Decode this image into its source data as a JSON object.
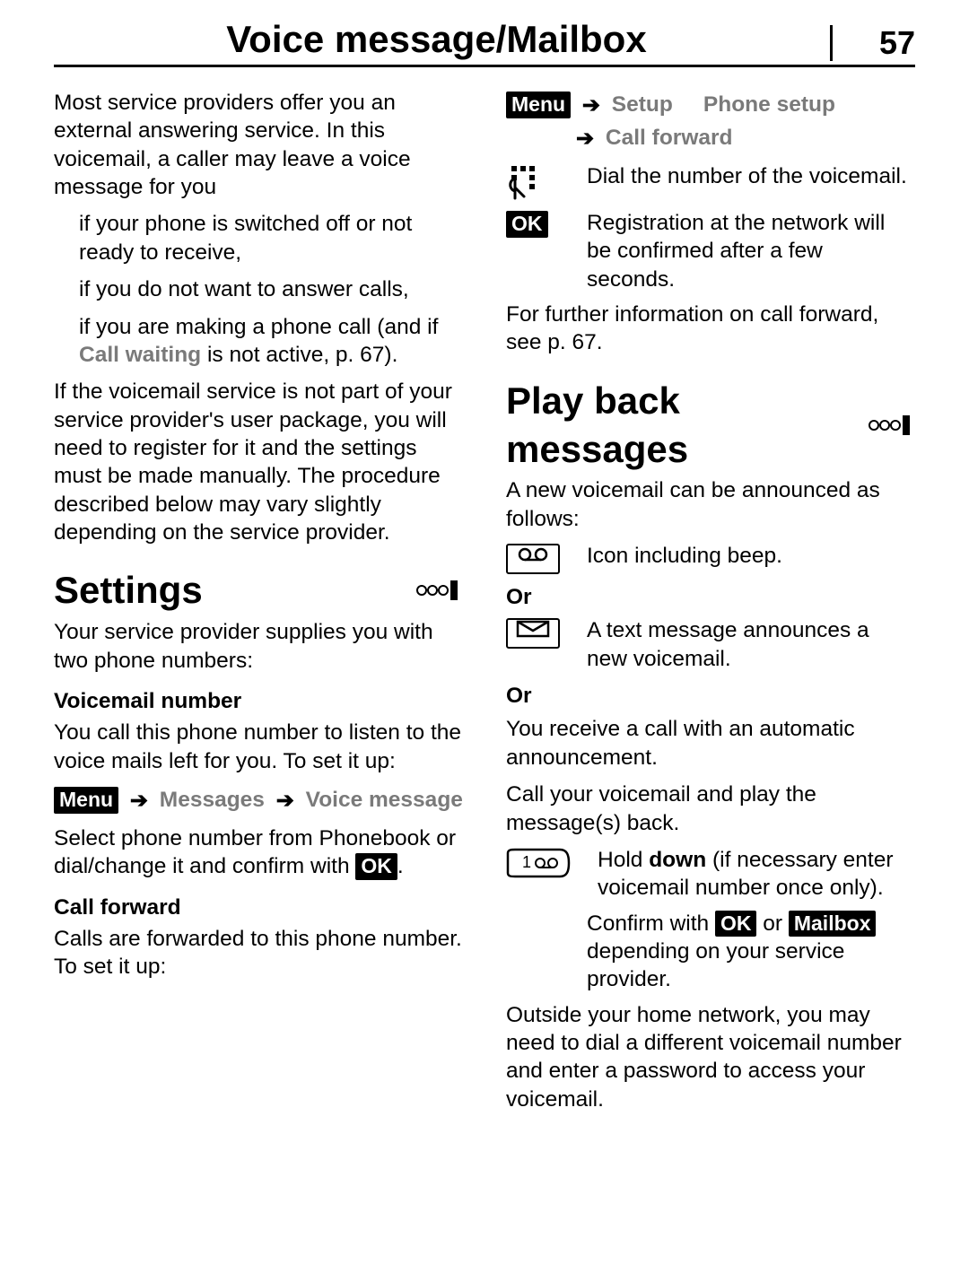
{
  "header": {
    "title": "Voice message/Mailbox",
    "page_number": "57"
  },
  "col1": {
    "intro": "Most service providers offer you an external answering service. In this voicemail, a caller may leave a voice message for you",
    "bullets": [
      "if your phone is switched off or not ready to receive,",
      "if you do not want to answer calls,",
      "if you are making a phone call (and if "
    ],
    "call_waiting": "Call waiting",
    "bullet3_suffix": " is not active, p. 67).",
    "voicemail_service": "If the voicemail service is not part of your service provider's user package, you will need to register for it and the settings must be made manually. The procedure described below may vary slightly depending on the service provider.",
    "settings_heading": "Settings",
    "provider_text": "Your service provider supplies you with two phone numbers:",
    "voicemail_number_heading": "Voicemail number",
    "voicemail_number_text": "You call this phone number to listen to the voice mails left for you. To set it up:",
    "menu_label": "Menu",
    "messages_label": "Messages",
    "voice_message_label": "Voice message",
    "select_phone_prefix": "Select phone number from Phonebook or dial/change it and confirm with ",
    "ok_label": "OK",
    "select_phone_suffix": ".",
    "call_forward_heading": "Call forward",
    "call_forward_text": "Calls are forwarded to this phone number. To set it up:"
  },
  "col2": {
    "menu_label": "Menu",
    "setup_label": "Setup",
    "phone_setup_label": "Phone setup",
    "call_forward_label": "Call forward",
    "dial_text": "Dial the number of the voicemail.",
    "ok_label": "OK",
    "registration_text": "Registration at the network will be confirmed after a few seconds.",
    "further_info": "For further information on call forward, see p. 67.",
    "playback_heading": "Play back messages",
    "announce_intro": "A new voicemail can be announced as follows:",
    "icon_beep": "Icon including beep.",
    "or_label": "Or",
    "text_message": "A text message announces a new voicemail.",
    "receive_call": "You receive a call with an automatic announcement.",
    "call_play": "Call your voicemail and play the message(s) back.",
    "hold_prefix": "Hold ",
    "down_label": "down",
    "hold_suffix": " (if necessary enter voicemail number once only).",
    "confirm_prefix": "Confirm with ",
    "confirm_middle": " or ",
    "mailbox_label": "Mailbox",
    "confirm_suffix": " depending on your service provider.",
    "outside_text": "Outside your home network, you may need to dial a different voicemail number and enter a password to access your voicemail."
  }
}
